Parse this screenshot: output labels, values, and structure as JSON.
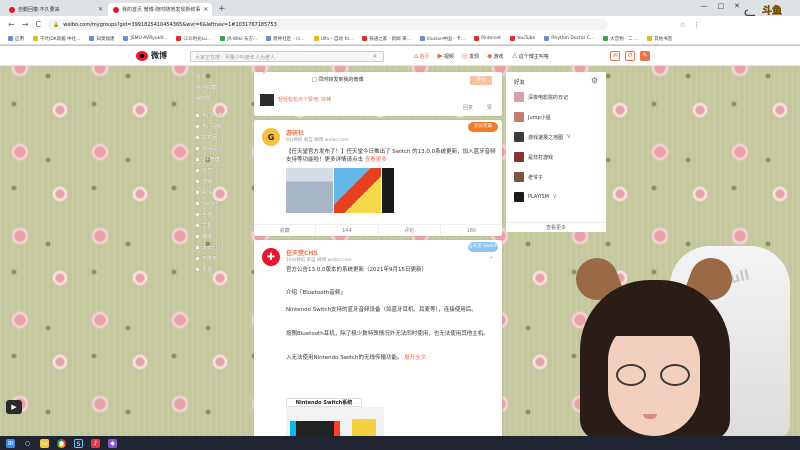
{
  "browser": {
    "tabs": [
      {
        "title": "自動回複·不久要来",
        "active": false
      },
      {
        "title": "我的首页 微博-随时随地发现新鲜事",
        "active": true
      }
    ],
    "new_tab": "+",
    "window_controls": [
      "—",
      "□",
      "✕"
    ],
    "nav": {
      "back": "←",
      "forward": "→",
      "reload": "C"
    },
    "url": "weibo.com/mygroups?gid=3991825410454365&wvr=6&leftnav=1#1031767185753",
    "toolbar_icons": [
      "☆",
      "⋮"
    ],
    "bookmarks": [
      "应用",
      "千叶JDK新搬 中社...",
      "知莫福建",
      "JSMU-AVRyuk9...",
      "(23)时光Lu...",
      "JR-Wiki-东方...",
      "原神社区 - 川...",
      "Ultv - 自动 fd...",
      "快递之家 - 新闻 来...",
      "Illusion中国 - 卡...",
      "Pinterest",
      "YouTube",
      "Rhythm Doctor C...",
      "大宫物 · 二 ...",
      "其他书签"
    ]
  },
  "logo": {
    "text": "斗鱼",
    "sub": "DOUYU.COM"
  },
  "weibo": {
    "brand": "微博",
    "search_placeholder": "大家正在搜：尽量少叫老年人为老人",
    "nav": [
      {
        "icon": "⌂",
        "label": "首页",
        "active": true
      },
      {
        "icon": "▶",
        "label": "视频",
        "active": false
      },
      {
        "icon": "◎",
        "label": "发现",
        "active": false
      },
      {
        "icon": "◆",
        "label": "游戏",
        "active": false
      },
      {
        "icon": "♙",
        "label": "这个博主叫啥",
        "active": false
      }
    ],
    "tools": [
      "✉",
      "⚙",
      "✎"
    ]
  },
  "leftnav": [
    {
      "label": "首页",
      "group": false
    },
    {
      "label": "我的收藏",
      "group": false
    },
    {
      "label": "我的赞",
      "group": false
    },
    {
      "label": "热门微博",
      "group": true
    },
    {
      "label": "热门视频",
      "group": false
    },
    {
      "label": "好友圈",
      "group": false
    },
    {
      "label": "特别关注",
      "group": false
    },
    {
      "label": "V+微博",
      "group": false
    },
    {
      "label": "综艺",
      "group": false
    },
    {
      "label": "游戏",
      "group": false
    },
    {
      "label": "ACG",
      "group": false
    },
    {
      "label": "Switch",
      "group": false
    },
    {
      "label": "手游",
      "group": false
    },
    {
      "label": "主机",
      "group": false
    },
    {
      "label": "推推",
      "group": false
    },
    {
      "label": "太太们",
      "group": false
    },
    {
      "label": "不推荐",
      "group": false
    },
    {
      "label": "更多",
      "group": false
    }
  ],
  "composer": {
    "prefix": "^",
    "text": "□ 同时转发到我的微博",
    "send": "评论",
    "reply_user": "轻轻松松点个赞吧: 好棒",
    "actions": [
      "回复",
      "赞"
    ]
  },
  "post1": {
    "avatar_letter": "G",
    "author": "游研社",
    "meta": "9分钟前 来自 微博 weibo.com",
    "badge": "会员专属",
    "text1": "【任天堂官方发布了！】任天堂今日推出了 Switch 的13.0.0系统更新，加入蓝牙音频",
    "text2": "支持等功能啦！更多详情请点击",
    "link": "查看更多",
    "actions": [
      "收藏",
      "144",
      "评论",
      "186"
    ]
  },
  "post2": {
    "avatar_letter": "✚",
    "author": "任天堂CHS",
    "meta": "10分钟前 来自 微博 weibo.com",
    "badge": "任天堂 Switch",
    "line1": "官方公告13.0.0版本的系统更新（2021年9月15日更新）",
    "quote": "介绍「Bluetooth音频」",
    "p1": "Nintendo Switch支持的蓝牙音频设备（如蓝牙耳机、耳麦等），连接使用后。",
    "p2": "按照Bluetooth耳机，除了极少数特殊情况外无法同时使用，也无法使用其他主机。",
    "p3": "入无法使用Nintendo Switch的无线传输功能。",
    "more": "展开全文",
    "switch_label": "Nintendo Switch系统"
  },
  "sidebar": {
    "title": "好友",
    "gear": "⚙",
    "items": [
      {
        "name": "深夜电影院的日记",
        "color": "#d6a0a8"
      },
      {
        "name": "Jump小屋",
        "color": "#c08070"
      },
      {
        "name": "游戏速报之地图",
        "color": "#3b3b3b"
      },
      {
        "name": "是非打游戏",
        "color": "#8a3030"
      },
      {
        "name": "老爷子",
        "color": "#7a5640"
      },
      {
        "name": "PLAYISM",
        "color": "#1a1a1a"
      }
    ],
    "more": "查看更多"
  },
  "play_icon": "▶",
  "chair_brand": "ArcoFull",
  "taskbar_icons": [
    "⊞",
    "○",
    "▭",
    "●",
    "S",
    "♪",
    "◆"
  ]
}
